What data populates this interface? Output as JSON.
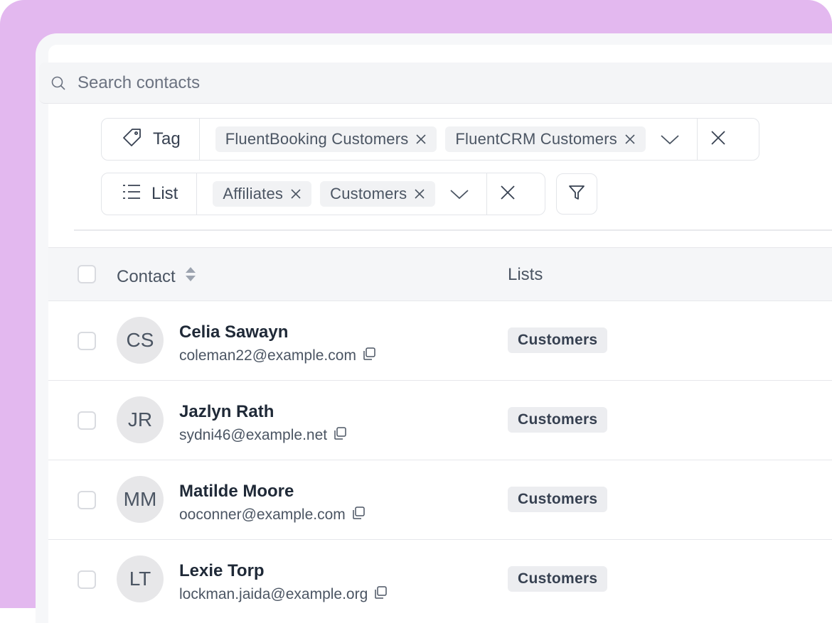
{
  "search": {
    "placeholder": "Search contacts"
  },
  "filters": {
    "tag": {
      "label": "Tag",
      "chips": [
        "FluentBooking Customers",
        "FluentCRM Customers"
      ]
    },
    "list": {
      "label": "List",
      "chips": [
        "Affiliates",
        "Customers"
      ]
    }
  },
  "table": {
    "headers": {
      "contact": "Contact",
      "lists": "Lists"
    },
    "rows": [
      {
        "initials": "CS",
        "name": "Celia Sawayn",
        "email": "coleman22@example.com",
        "list": "Customers"
      },
      {
        "initials": "JR",
        "name": "Jazlyn Rath",
        "email": "sydni46@example.net",
        "list": "Customers"
      },
      {
        "initials": "MM",
        "name": "Matilde Moore",
        "email": "ooconner@example.com",
        "list": "Customers"
      },
      {
        "initials": "LT",
        "name": "Lexie Torp",
        "email": "lockman.jaida@example.org",
        "list": "Customers"
      }
    ]
  },
  "colors": {
    "frame": "#e3b8ef",
    "chip_bg": "#f1f2f4",
    "badge_bg": "#ecedf0"
  },
  "icons": [
    "search-icon",
    "tag-icon",
    "list-icon",
    "close-icon",
    "chevron-down-icon",
    "filter-icon",
    "sort-icon",
    "copy-icon"
  ]
}
